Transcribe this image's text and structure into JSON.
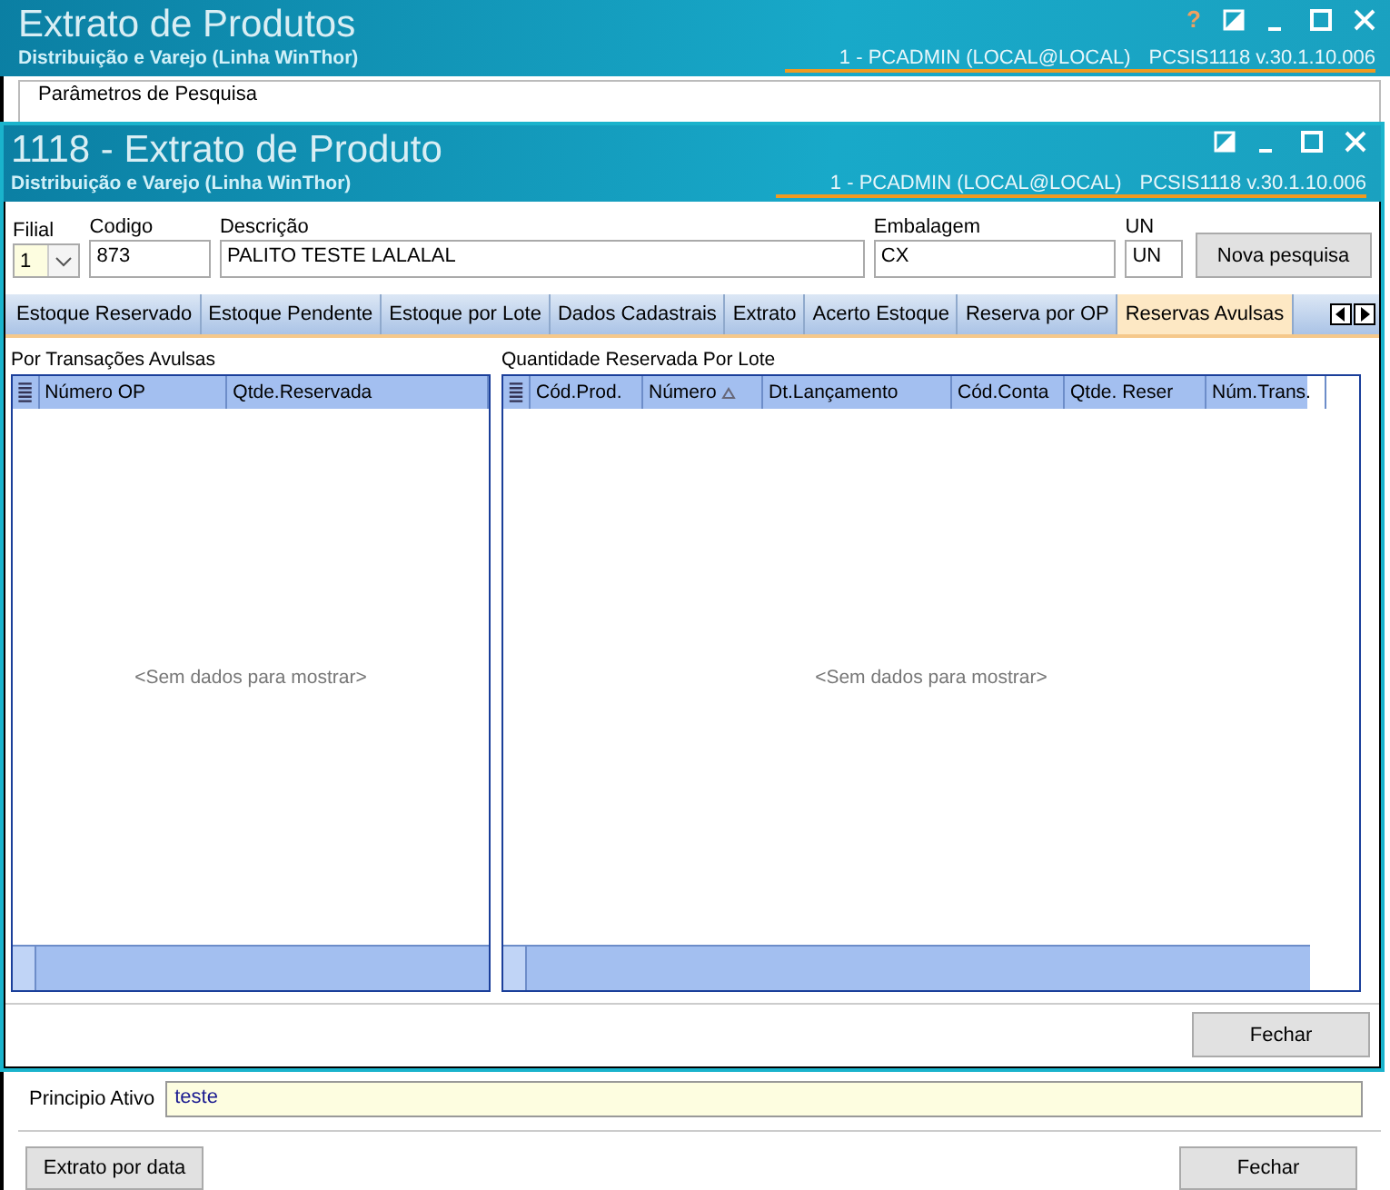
{
  "back_window": {
    "help": "?",
    "title": "Extrato de Produtos",
    "subtitle": "Distribuição e Varejo (Linha WinThor)",
    "session": "1 - PCADMIN (LOCAL@LOCAL)",
    "version": "PCSIS1118  v.30.1.10.006",
    "group_title": "Parâmetros de Pesquisa",
    "principio_label": "Principio Ativo",
    "principio_value": "teste",
    "buttons": [
      "Extrato por data",
      "Fechar"
    ]
  },
  "window": {
    "title": "1118 - Extrato de Produto",
    "subtitle": "Distribuição e Varejo (Linha WinThor)",
    "session": "1 - PCADMIN (LOCAL@LOCAL)",
    "version": "PCSIS1118  v.30.1.10.006"
  },
  "fields": [
    {
      "label": "Filial",
      "value": "1",
      "kind": "combo"
    },
    {
      "label": "Codigo",
      "value": "873",
      "kind": "text"
    },
    {
      "label": "Descrição",
      "value": "PALITO TESTE LALALAL",
      "kind": "text"
    },
    {
      "label": "Embalagem",
      "value": "CX",
      "kind": "text"
    },
    {
      "label": "UN",
      "value": "UN",
      "kind": "text"
    }
  ],
  "search_button": "Nova pesquisa",
  "tabs": [
    {
      "label": "Estoque Reservado",
      "selected": false
    },
    {
      "label": "Estoque Pendente",
      "selected": false
    },
    {
      "label": "Estoque por Lote",
      "selected": false
    },
    {
      "label": "Dados Cadastrais",
      "selected": false
    },
    {
      "label": "Extrato",
      "selected": false
    },
    {
      "label": "Acerto Estoque",
      "selected": false
    },
    {
      "label": "Reserva por OP",
      "selected": false
    },
    {
      "label": "Reservas Avulsas",
      "selected": true
    }
  ],
  "grids": [
    {
      "title": "Por Transações Avulsas",
      "columns": [
        {
          "label": "Número OP",
          "sorted": false
        },
        {
          "label": "Qtde.Reservada",
          "sorted": false
        }
      ],
      "empty_text": "<Sem dados para mostrar>"
    },
    {
      "title": "Quantidade Reservada Por Lote",
      "columns": [
        {
          "label": "Cód.Prod.",
          "sorted": false
        },
        {
          "label": "Número",
          "sorted": true
        },
        {
          "label": "Dt.Lançamento",
          "sorted": false
        },
        {
          "label": "Cód.Conta",
          "sorted": false
        },
        {
          "label": "Qtde. Reser",
          "sorted": false
        },
        {
          "label": "Núm.Trans.",
          "sorted": false
        }
      ],
      "empty_text": "<Sem dados para mostrar>"
    }
  ],
  "close_button": "Fechar"
}
